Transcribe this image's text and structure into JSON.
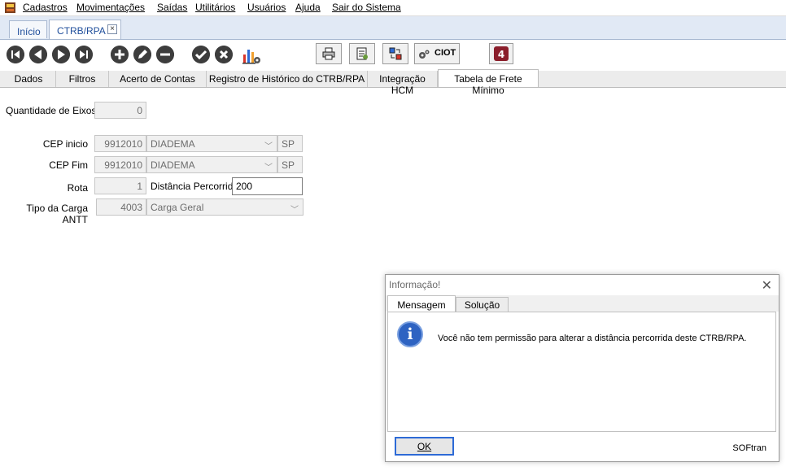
{
  "menu": {
    "items": [
      "Cadastros",
      "Movimentações",
      "Saídas",
      "Utilitários",
      "Usuários",
      "Ajuda",
      "Sair do Sistema"
    ]
  },
  "doc_tabs": [
    {
      "label": "Início",
      "active": false
    },
    {
      "label": "CTRB/RPA",
      "active": true,
      "closable": true
    }
  ],
  "toolbar": {
    "nav_icons": [
      "first-record-icon",
      "previous-record-icon",
      "next-record-icon",
      "last-record-icon"
    ],
    "edit_icons": [
      "add-icon",
      "edit-icon",
      "remove-icon"
    ],
    "action_icons": [
      "confirm-icon",
      "cancel-icon",
      "chart-settings-icon"
    ],
    "print_icon": "printer-icon",
    "report_icon": "report-icon",
    "transfer_icon": "transfer-icon",
    "ciot_label": "CIOT",
    "brand_icon": "logo-icon"
  },
  "section_tabs": [
    "Dados",
    "Filtros",
    "Acerto de Contas",
    "Registro de Histórico do CTRB/RPA",
    "Integração HCM",
    "Tabela de Frete Mínimo"
  ],
  "active_section_tab": "Tabela de Frete Mínimo",
  "form": {
    "qtd_eixos": {
      "label": "Quantidade de Eixos",
      "value": "0"
    },
    "cep_inicio": {
      "label": "CEP inicio",
      "code": "9912010",
      "city": "DIADEMA",
      "uf": "SP"
    },
    "cep_fim": {
      "label": "CEP Fim",
      "code": "9912010",
      "city": "DIADEMA",
      "uf": "SP"
    },
    "rota": {
      "label": "Rota",
      "value": "1"
    },
    "distancia": {
      "label": "Distância Percorrida",
      "value": "200"
    },
    "tipo_carga": {
      "label": "Tipo da Carga ANTT",
      "code": "4003",
      "name": "Carga Geral"
    }
  },
  "dialog": {
    "title": "Informação!",
    "tabs": [
      "Mensagem",
      "Solução"
    ],
    "active_tab": "Mensagem",
    "message": "Você não tem permissão para alterar a distância percorrida deste CTRB/RPA.",
    "ok_label": "OK",
    "brand": "SOFtran"
  },
  "colors": {
    "doc_tab_bar": "#e1e9f5",
    "doc_tab_text": "#1f4e9b",
    "icon_dark": "#3d3d3d",
    "info_blue": "#2e63c2",
    "ok_border": "#2d6ad6"
  }
}
